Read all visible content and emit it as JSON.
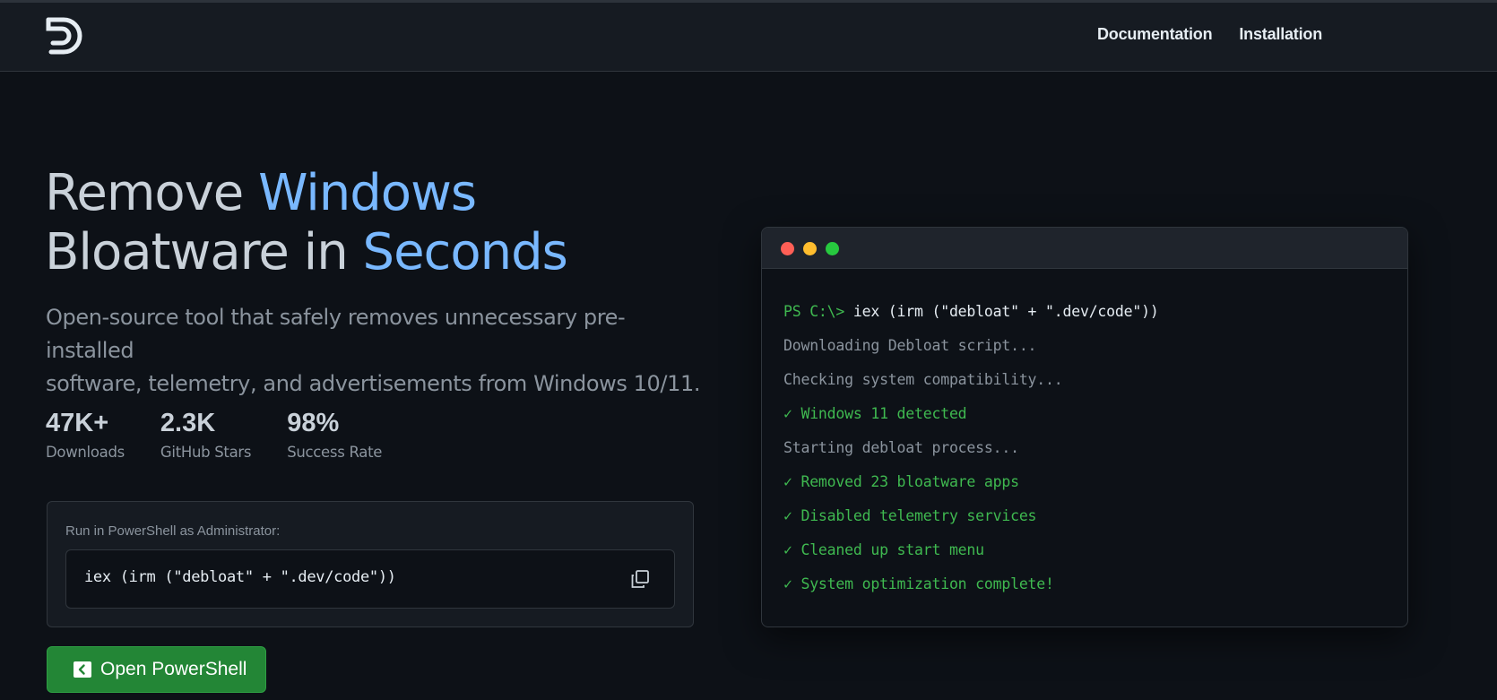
{
  "nav": {
    "links": [
      "Documentation",
      "Installation"
    ]
  },
  "hero": {
    "title_line1_plain": "Remove ",
    "title_line1_accent": "Windows",
    "title_line2_plain": "Bloatware in ",
    "title_line2_accent": "Seconds",
    "subtitle_line1": "Open-source tool that safely removes unnecessary pre-installed",
    "subtitle_line2": "software, telemetry, and advertisements from Windows 10/11."
  },
  "stats": [
    {
      "value": "47K+",
      "label": "Downloads"
    },
    {
      "value": "2.3K",
      "label": "GitHub Stars"
    },
    {
      "value": "98%",
      "label": "Success Rate"
    }
  ],
  "command": {
    "label": "Run in PowerShell as Administrator:",
    "text": "iex (irm (\"debloat\" + \".dev/code\"))"
  },
  "cta": {
    "label": "Open PowerShell"
  },
  "terminal": {
    "prompt": "PS C:\\> ",
    "command": "iex (irm (\"debloat\" + \".dev/code\"))",
    "lines": [
      {
        "text": "Downloading Debloat script...",
        "kind": "out"
      },
      {
        "text": "Checking system compatibility...",
        "kind": "out"
      },
      {
        "text": "✓ Windows 11 detected",
        "kind": "ok"
      },
      {
        "text": "Starting debloat process...",
        "kind": "out"
      },
      {
        "text": "✓ Removed 23 bloatware apps",
        "kind": "ok"
      },
      {
        "text": "✓ Disabled telemetry services",
        "kind": "ok"
      },
      {
        "text": "✓ Cleaned up start menu",
        "kind": "ok"
      },
      {
        "text": "✓ System optimization complete!",
        "kind": "ok"
      }
    ]
  },
  "colors": {
    "background": "#0d1117",
    "accent": "#79b8ff",
    "success": "#3fb950",
    "button": "#238636"
  },
  "icons": {
    "logo": "debloat-logo-icon",
    "copy": "copy-icon",
    "powershell": "powershell-icon"
  }
}
